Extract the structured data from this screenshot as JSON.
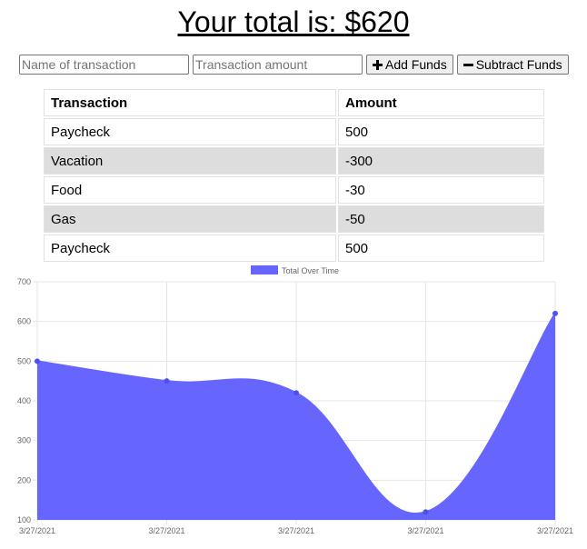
{
  "header": {
    "prefix": "Your total is: ",
    "amount": "$620"
  },
  "form": {
    "name_placeholder": "Name of transaction",
    "amount_placeholder": "Transaction amount",
    "add_label": "Add Funds",
    "subtract_label": "Subtract Funds",
    "add_icon": "plus-icon",
    "subtract_icon": "minus-icon"
  },
  "table": {
    "headers": [
      "Transaction",
      "Amount"
    ],
    "rows": [
      [
        "Paycheck",
        "500"
      ],
      [
        "Vacation",
        "-300"
      ],
      [
        "Food",
        "-30"
      ],
      [
        "Gas",
        "-50"
      ],
      [
        "Paycheck",
        "500"
      ]
    ]
  },
  "chart_data": {
    "type": "area",
    "categories": [
      "3/27/2021",
      "3/27/2021",
      "3/27/2021",
      "3/27/2021",
      "3/27/2021"
    ],
    "series": [
      {
        "name": "Total Over Time",
        "values": [
          500,
          450,
          420,
          120,
          620
        ],
        "color": "#6666ff"
      }
    ],
    "ylim": [
      100,
      700
    ],
    "yticks": [
      100,
      200,
      300,
      400,
      500,
      600,
      700
    ],
    "grid": true,
    "legend_position": "top-center"
  }
}
